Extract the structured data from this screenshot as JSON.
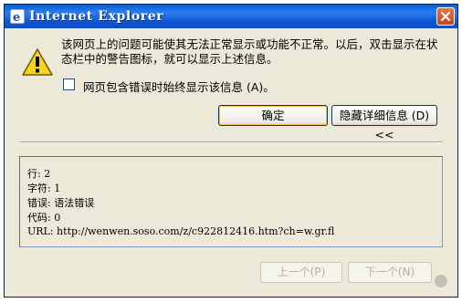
{
  "window": {
    "title": "Internet Explorer"
  },
  "message": {
    "text": "该网页上的问题可能使其无法正常显示或功能不正常。以后，双击显示在状态栏中的警告图标，就可以显示上述信息。",
    "checkbox_label": "网页包含错误时始终显示该信息 (A)。",
    "checkbox_checked": false
  },
  "buttons": {
    "ok": "确定",
    "details": "隐藏详细信息 (D) <<",
    "prev": "上一个(P)",
    "next": "下一个(N)"
  },
  "details": {
    "line": "行: 2",
    "char": "字符: 1",
    "error": "错误: 语法错误",
    "code": "代码: 0",
    "url": "URL:  http://wenwen.soso.com/z/c922812416.htm?ch=w.gr.fl"
  },
  "icons": [
    "ie-logo-icon",
    "close-icon",
    "warning-icon",
    "baidu-paw-icon"
  ],
  "colors": {
    "titlebar": "#0a5fd8",
    "dialog_bg": "#ece9d8",
    "close_button": "#e0582e",
    "button_border": "#003c74"
  }
}
